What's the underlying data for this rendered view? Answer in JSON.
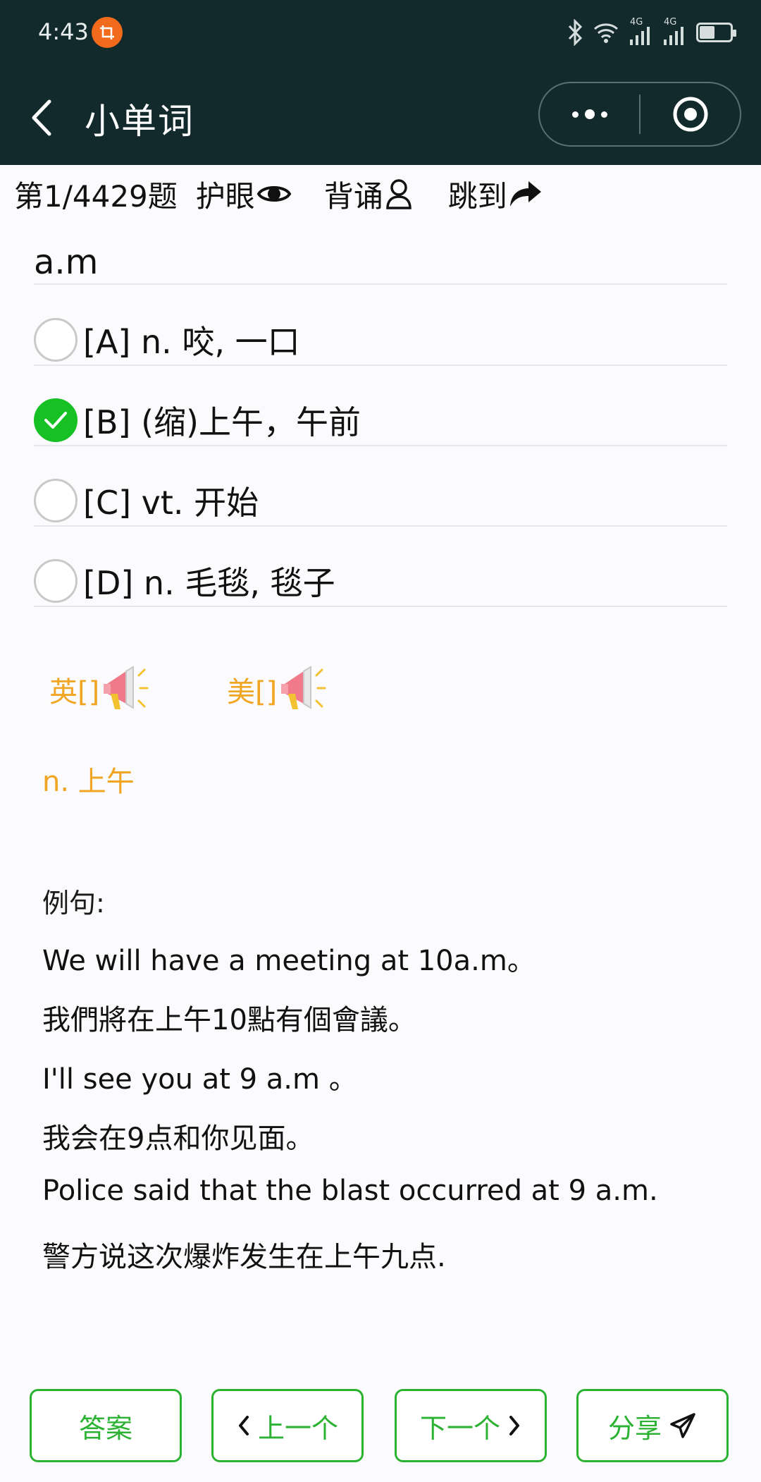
{
  "status_bar": {
    "time": "4:43",
    "app_badge_icon": "crop-icon",
    "network_labels": [
      "4G",
      "4G"
    ],
    "battery_level": 0.45
  },
  "nav": {
    "title": "小单词"
  },
  "toolbar": {
    "progress": "第1/4429题",
    "eye_care": "护眼",
    "recite": "背诵",
    "jump": "跳到"
  },
  "question": {
    "word": "a.m",
    "options": [
      {
        "label": "[A] n. 咬, 一口",
        "selected": false
      },
      {
        "label": "[B] (缩)上午，午前",
        "selected": true
      },
      {
        "label": "[C] vt. 开始",
        "selected": false
      },
      {
        "label": "[D] n. 毛毯, 毯子",
        "selected": false
      }
    ]
  },
  "pronunciation": {
    "uk": "英[]",
    "us": "美[]"
  },
  "definition": "n. 上午",
  "examples": {
    "title": "例句:",
    "lines": [
      "We will have a meeting at 10a.m。",
      "我們將在上午10點有個會議。",
      "I'll see you at 9 a.m 。",
      "我会在9点和你见面。",
      "Police said that the blast occurred at 9 a.m.",
      "警方说这次爆炸发生在上午九点."
    ]
  },
  "bottom_bar": {
    "answer": "答案",
    "prev": "上一个",
    "next": "下一个",
    "share": "分享"
  },
  "colors": {
    "header_bg": "#132a2c",
    "accent_green": "#2bb232",
    "checked_green": "#17c125",
    "pronunciation_orange": "#f0a623"
  }
}
